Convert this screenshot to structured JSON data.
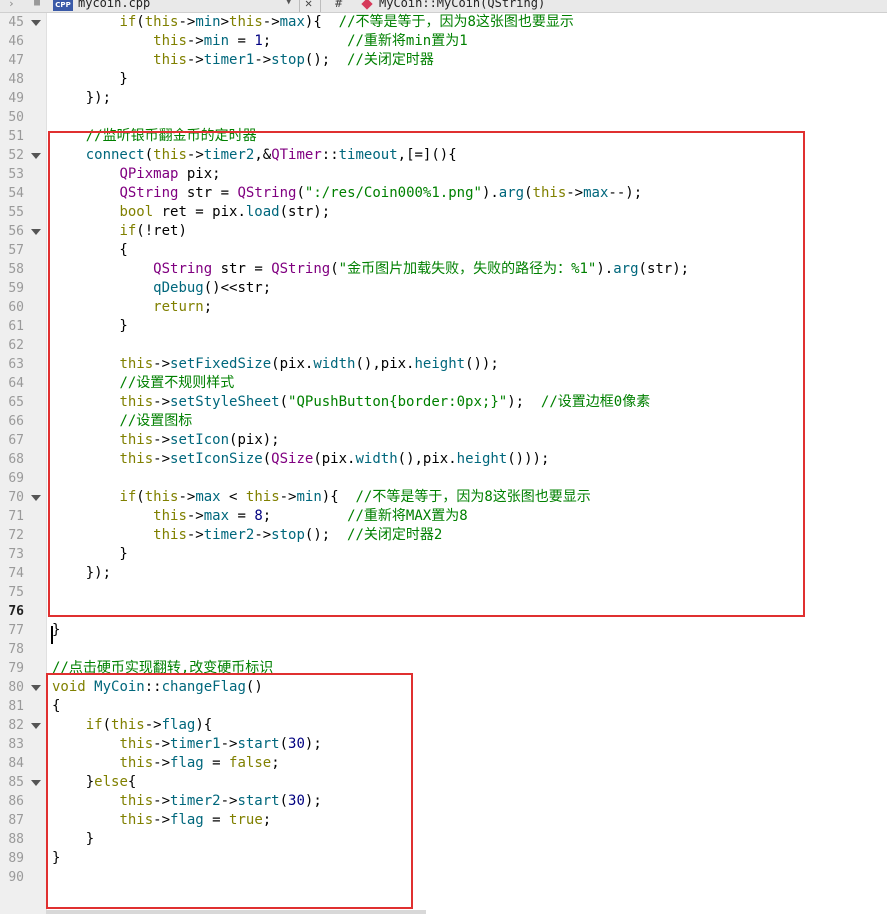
{
  "tabbar": {
    "file_name": "mycoin.cpp",
    "file_badge": "CPP",
    "hash": "#",
    "function_name": "MyCoin::MyCoin(QString)"
  },
  "colors": {
    "keyword": "#808000",
    "type": "#800080",
    "function": "#00677c",
    "number": "#000080",
    "string": "#008000",
    "comment": "#008000",
    "highlight_box": "#e03030"
  },
  "code_lines": [
    {
      "n": "45",
      "fold": true,
      "code": "        if(this->min>this->max){  //不等是等于，因为8这张图也要显示"
    },
    {
      "n": "46",
      "fold": false,
      "code": "            this->min = 1;         //重新将min置为1"
    },
    {
      "n": "47",
      "fold": false,
      "code": "            this->timer1->stop();  //关闭定时器"
    },
    {
      "n": "48",
      "fold": false,
      "code": "        }"
    },
    {
      "n": "49",
      "fold": false,
      "code": "    });"
    },
    {
      "n": "50",
      "fold": false,
      "code": ""
    },
    {
      "n": "51",
      "fold": false,
      "code": "    //监听银币翻金币的定时器"
    },
    {
      "n": "52",
      "fold": true,
      "code": "    connect(this->timer2,&QTimer::timeout,[=](){"
    },
    {
      "n": "53",
      "fold": false,
      "code": "        QPixmap pix;"
    },
    {
      "n": "54",
      "fold": false,
      "code": "        QString str = QString(\":/res/Coin000%1.png\").arg(this->max--);"
    },
    {
      "n": "55",
      "fold": false,
      "code": "        bool ret = pix.load(str);"
    },
    {
      "n": "56",
      "fold": true,
      "code": "        if(!ret)"
    },
    {
      "n": "57",
      "fold": false,
      "code": "        {"
    },
    {
      "n": "58",
      "fold": false,
      "code": "            QString str = QString(\"金币图片加载失败，失败的路径为：%1\").arg(str);"
    },
    {
      "n": "59",
      "fold": false,
      "code": "            qDebug()<<str;"
    },
    {
      "n": "60",
      "fold": false,
      "code": "            return;"
    },
    {
      "n": "61",
      "fold": false,
      "code": "        }"
    },
    {
      "n": "62",
      "fold": false,
      "code": ""
    },
    {
      "n": "63",
      "fold": false,
      "code": "        this->setFixedSize(pix.width(),pix.height());"
    },
    {
      "n": "64",
      "fold": false,
      "code": "        //设置不规则样式"
    },
    {
      "n": "65",
      "fold": false,
      "code": "        this->setStyleSheet(\"QPushButton{border:0px;}\");  //设置边框0像素"
    },
    {
      "n": "66",
      "fold": false,
      "code": "        //设置图标"
    },
    {
      "n": "67",
      "fold": false,
      "code": "        this->setIcon(pix);"
    },
    {
      "n": "68",
      "fold": false,
      "code": "        this->setIconSize(QSize(pix.width(),pix.height()));"
    },
    {
      "n": "69",
      "fold": false,
      "code": ""
    },
    {
      "n": "70",
      "fold": true,
      "code": "        if(this->max < this->min){  //不等是等于，因为8这张图也要显示"
    },
    {
      "n": "71",
      "fold": false,
      "code": "            this->max = 8;         //重新将MAX置为8"
    },
    {
      "n": "72",
      "fold": false,
      "code": "            this->timer2->stop();  //关闭定时器2"
    },
    {
      "n": "73",
      "fold": false,
      "code": "        }"
    },
    {
      "n": "74",
      "fold": false,
      "code": "    });"
    },
    {
      "n": "75",
      "fold": false,
      "code": ""
    },
    {
      "n": "76",
      "fold": false,
      "code": "",
      "current": true
    },
    {
      "n": "77",
      "fold": false,
      "code": "}"
    },
    {
      "n": "78",
      "fold": false,
      "code": ""
    },
    {
      "n": "79",
      "fold": false,
      "code": "//点击硬币实现翻转,改变硬币标识"
    },
    {
      "n": "80",
      "fold": true,
      "code": "void MyCoin::changeFlag()"
    },
    {
      "n": "81",
      "fold": false,
      "code": "{"
    },
    {
      "n": "82",
      "fold": true,
      "code": "    if(this->flag){"
    },
    {
      "n": "83",
      "fold": false,
      "code": "        this->timer1->start(30);"
    },
    {
      "n": "84",
      "fold": false,
      "code": "        this->flag = false;"
    },
    {
      "n": "85",
      "fold": true,
      "code": "    }else{"
    },
    {
      "n": "86",
      "fold": false,
      "code": "        this->timer2->start(30);"
    },
    {
      "n": "87",
      "fold": false,
      "code": "        this->flag = true;"
    },
    {
      "n": "88",
      "fold": false,
      "code": "    }"
    },
    {
      "n": "89",
      "fold": false,
      "code": "}"
    },
    {
      "n": "90",
      "fold": false,
      "code": ""
    }
  ]
}
